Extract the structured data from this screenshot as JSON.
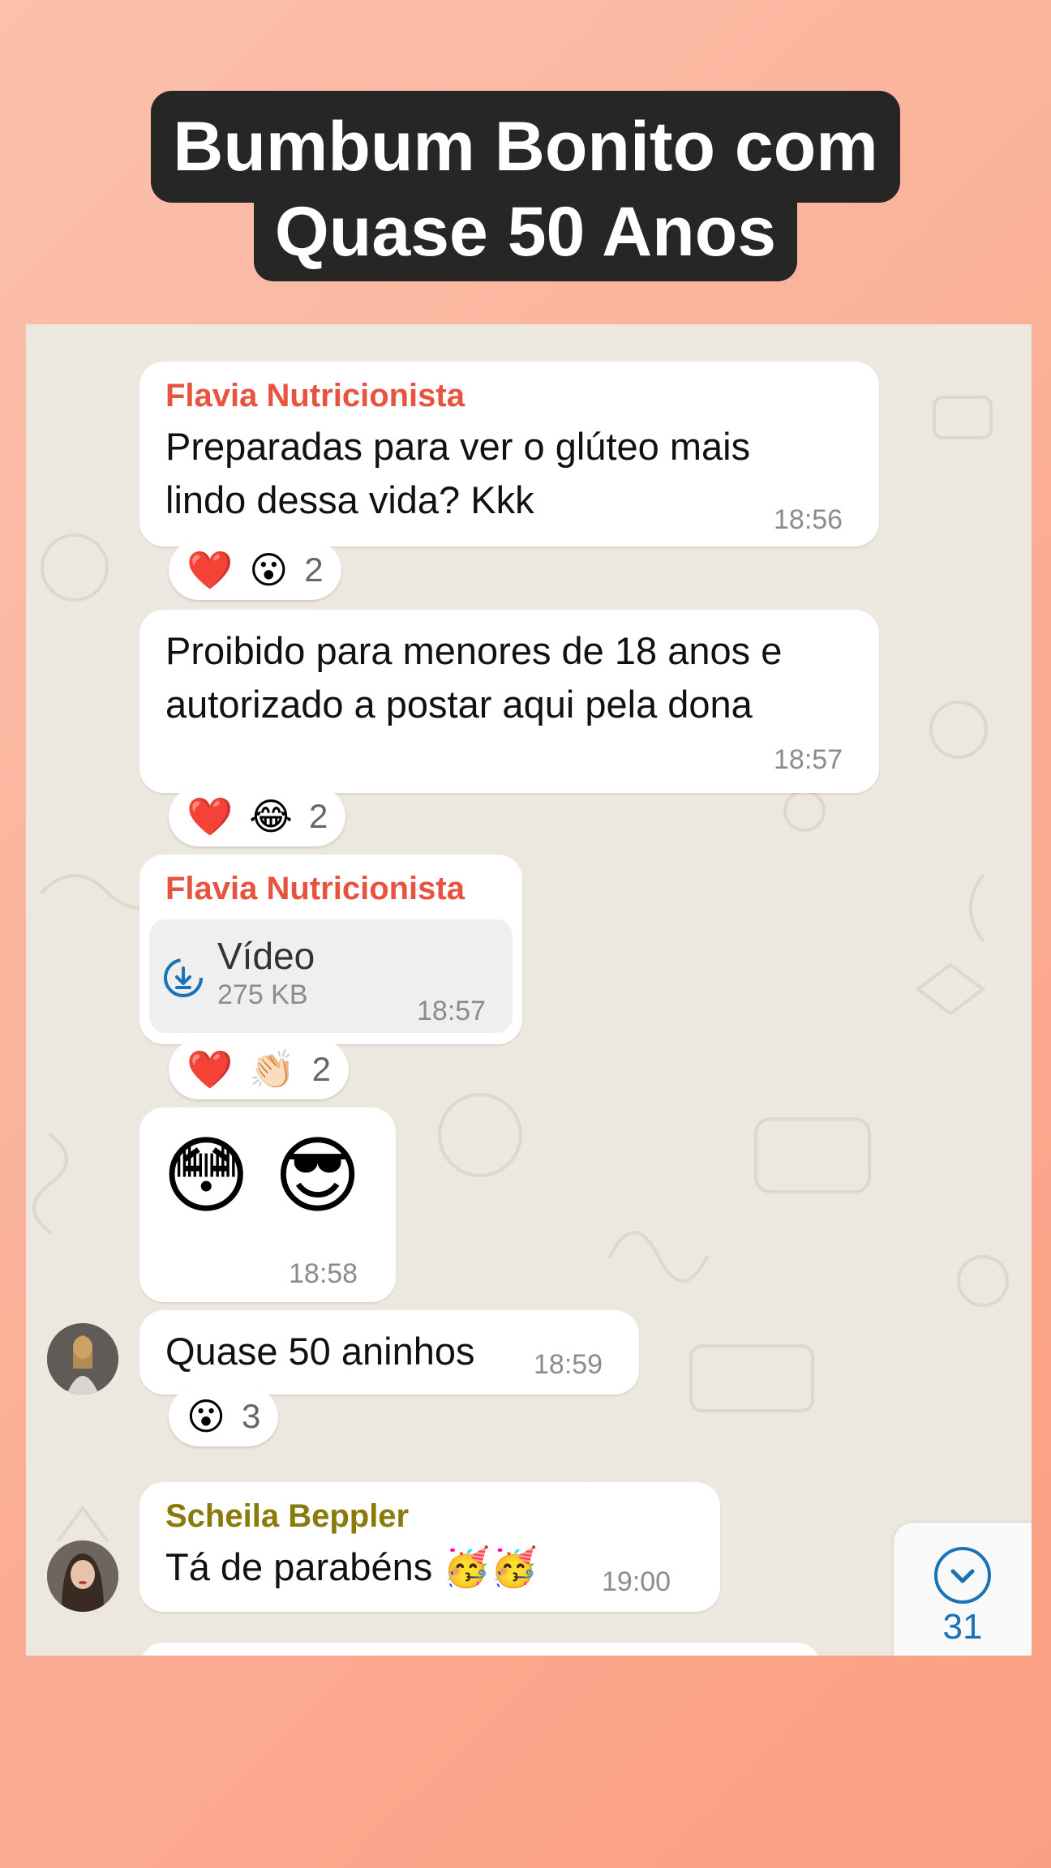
{
  "overlay": {
    "title_line1": "Bumbum Bonito com",
    "title_line2": "Quase 50 Anos"
  },
  "colors": {
    "flavia_name": "#e8533f",
    "scheila_name": "#8a7a0a",
    "time": "#8c8c8c",
    "accent_blue": "#1a73b5",
    "chat_bg": "#ece7df"
  },
  "messages": [
    {
      "sender": "Flavia Nutricionista",
      "line1": "Preparadas para ver o glúteo mais",
      "line2": "lindo dessa vida? Kkk",
      "time": "18:56",
      "reactions": {
        "emoji1": "❤️",
        "emoji2": "😮",
        "count": "2"
      }
    },
    {
      "line1": "Proibido para menores de 18 anos e",
      "line2": "autorizado a postar aqui pela dona",
      "time": "18:57",
      "reactions": {
        "emoji1": "❤️",
        "emoji2": "😂",
        "count": "2"
      }
    },
    {
      "sender": "Flavia Nutricionista",
      "video_label": "Vídeo",
      "video_size": "275 KB",
      "video_icon": "download-icon",
      "time": "18:57",
      "reactions": {
        "emoji1": "❤️",
        "emoji2": "👏🏻",
        "count": "2"
      }
    },
    {
      "emojis": "😳 😎",
      "time": "18:58"
    },
    {
      "text": "Quase 50 aninhos",
      "time": "18:59",
      "reactions": {
        "emoji1": "😮",
        "count": "3"
      }
    },
    {
      "sender": "Scheila Beppler",
      "text": "Tá de parabéns 🥳🥳",
      "time": "19:00"
    }
  ],
  "scroll_button": {
    "icon": "chevron-down-icon",
    "unread": "31"
  }
}
